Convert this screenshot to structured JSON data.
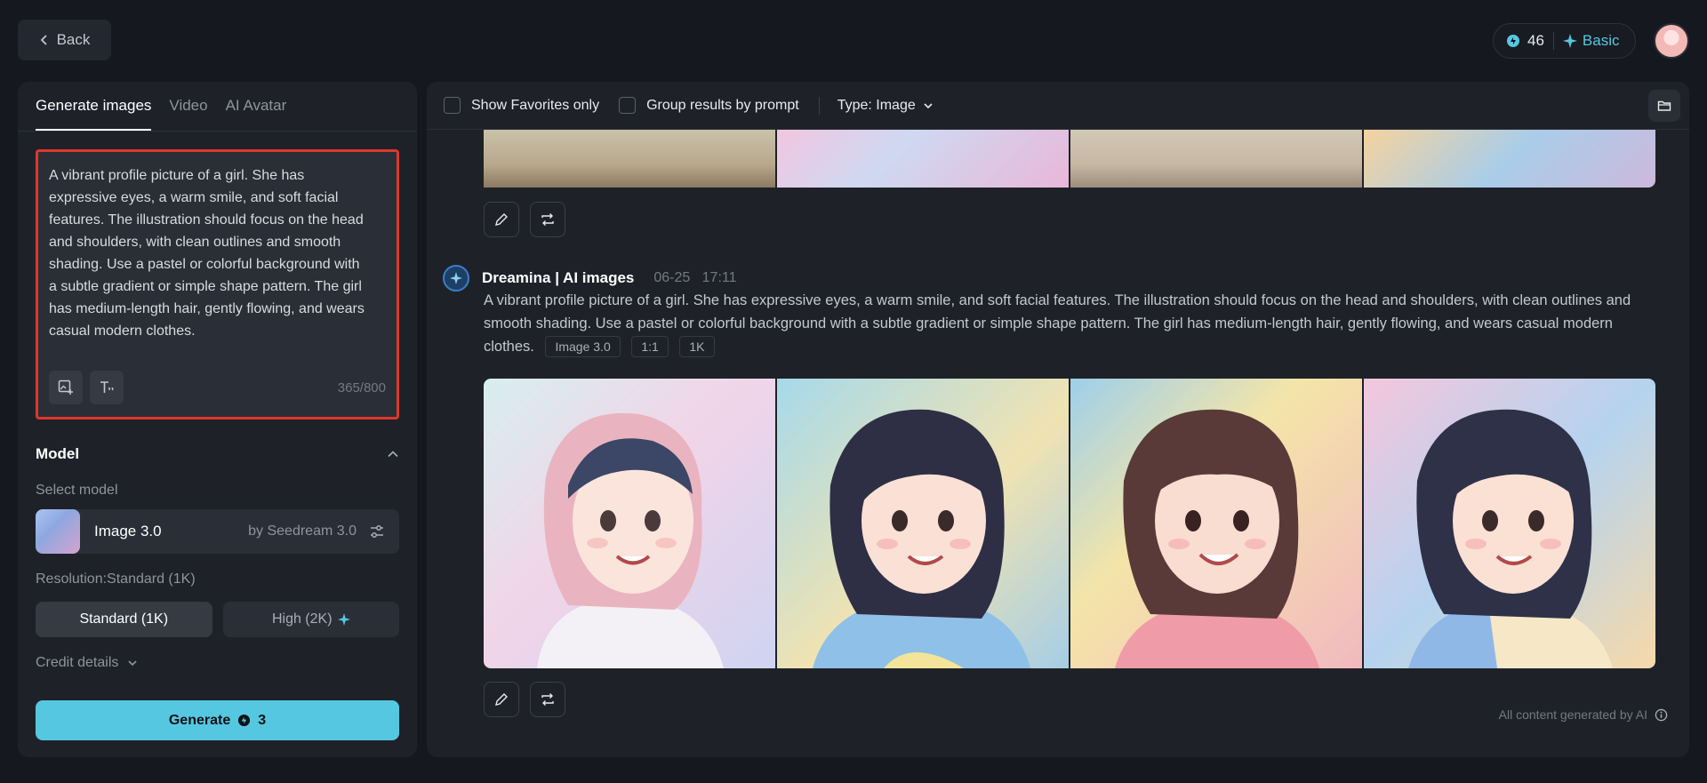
{
  "header": {
    "back_label": "Back",
    "credits": "46",
    "plan": "Basic"
  },
  "left": {
    "tabs": [
      "Generate images",
      "Video",
      "AI Avatar"
    ],
    "prompt": "A vibrant profile picture of a girl. She has expressive eyes, a warm smile, and soft facial features. The illustration should focus on the head and shoulders, with clean outlines and smooth shading. Use a pastel or colorful background with a subtle gradient or simple shape pattern. The girl has medium-length hair, gently flowing, and wears casual modern clothes.",
    "char_count": "365/800",
    "model_title": "Model",
    "select_model_label": "Select model",
    "model_name": "Image 3.0",
    "model_by": "by Seedream 3.0",
    "resolution_label": "Resolution:Standard (1K)",
    "res_standard": "Standard (1K)",
    "res_high": "High (2K)",
    "credit_details": "Credit details",
    "generate_label": "Generate",
    "generate_cost": "3"
  },
  "right": {
    "filter_favorites": "Show Favorites only",
    "filter_group": "Group results by prompt",
    "type_select": "Type: Image",
    "entry": {
      "author": "Dreamina | AI images",
      "date": "06-25",
      "time": "17:11",
      "prompt": "A vibrant profile picture of a girl. She has expressive eyes, a warm smile, and soft facial features. The illustration should focus on the head and shoulders, with clean outlines and smooth shading. Use a pastel or colorful background with a subtle gradient or simple shape pattern. The girl has medium-length hair, gently flowing, and wears casual modern clothes.",
      "tags": [
        "Image 3.0",
        "1:1",
        "1K"
      ]
    },
    "footer_note": "All content generated by AI"
  },
  "colors": {
    "accent": "#56c7e0",
    "highlight_border": "#e0362c",
    "panel": "#1e2228",
    "background": "#15181e"
  }
}
